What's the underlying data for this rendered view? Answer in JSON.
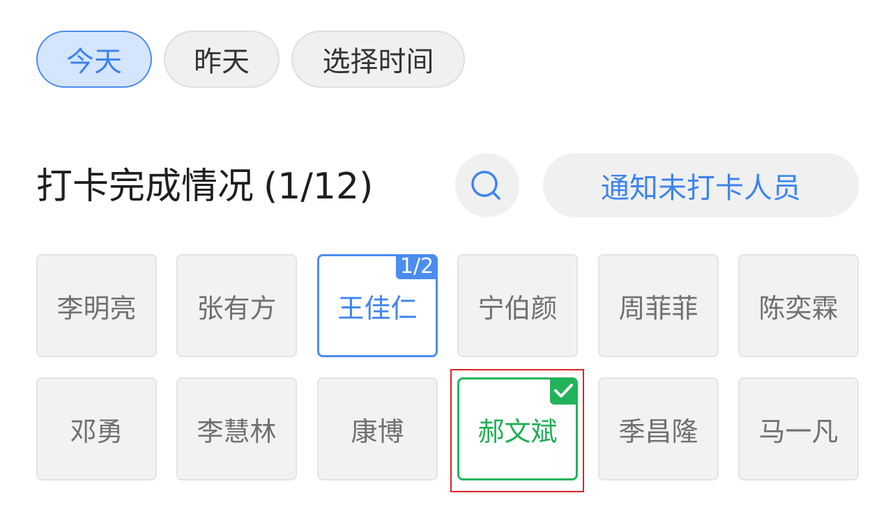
{
  "filters": [
    {
      "label": "今天",
      "selected": true
    },
    {
      "label": "昨天",
      "selected": false
    },
    {
      "label": "选择时间",
      "selected": false
    }
  ],
  "checkin": {
    "title": "打卡完成情况",
    "progress": "(1/12)",
    "search_icon": "search-icon",
    "notify_button": "通知未打卡人员"
  },
  "members": [
    {
      "name": "李明亮",
      "partial": false,
      "complete": false
    },
    {
      "name": "张有方",
      "partial": false,
      "complete": false
    },
    {
      "name": "王佳仁",
      "partial": true,
      "complete": false,
      "badge": "1/2"
    },
    {
      "name": "宁伯颜",
      "partial": false,
      "complete": false
    },
    {
      "name": "周菲菲",
      "partial": false,
      "complete": false
    },
    {
      "name": "陈奕霖",
      "partial": false,
      "complete": false
    },
    {
      "name": "邓勇",
      "partial": false,
      "complete": false
    },
    {
      "name": "李慧林",
      "partial": false,
      "complete": false
    },
    {
      "name": "康博",
      "partial": false,
      "complete": false
    },
    {
      "name": "郝文斌",
      "partial": false,
      "complete": true,
      "badge_icon": "check-icon",
      "highlighted": true
    },
    {
      "name": "季昌隆",
      "partial": false,
      "complete": false
    },
    {
      "name": "马一凡",
      "partial": false,
      "complete": false
    }
  ],
  "colors": {
    "accent": "#3d84ee",
    "accent_bg": "#d5e5fd",
    "success": "#22b35a",
    "highlight": "#e22222",
    "chip_bg": "#f2f2f2",
    "chip_border": "#e3e3e3"
  }
}
